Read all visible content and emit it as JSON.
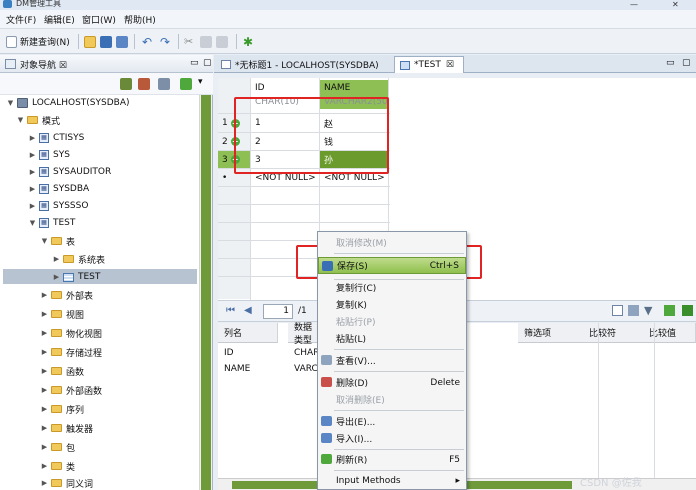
{
  "window": {
    "title": "DM管理工具"
  },
  "menu": [
    "文件(F)",
    "编辑(E)",
    "窗口(W)",
    "帮助(H)"
  ],
  "toolbar": {
    "new_query": "新建查询(N)"
  },
  "navigator": {
    "title": "对象导航",
    "close": "☒",
    "tree": {
      "server": "LOCALHOST(SYSDBA)",
      "schema_group": "模式",
      "schemas": [
        "CTISYS",
        "SYS",
        "SYSAUDITOR",
        "SYSDBA",
        "SYSSSO",
        "TEST"
      ],
      "table_group": "表",
      "system_tables": "系统表",
      "selected_table": "TEST",
      "other_groups": [
        "外部表",
        "视图",
        "物化视图",
        "存储过程",
        "函数",
        "外部函数",
        "序列",
        "触发器",
        "包",
        "类",
        "同义词"
      ]
    }
  },
  "tabs": [
    {
      "label": "*无标题1 - LOCALHOST(SYSDBA)"
    },
    {
      "label": "*TEST",
      "close": "☒"
    }
  ],
  "grid": {
    "columns": [
      {
        "name": "ID",
        "type": "CHAR(10)"
      },
      {
        "name": "NAME",
        "type": "VARCHAR2(50)"
      }
    ],
    "rows": [
      {
        "num": "1",
        "id": "1",
        "name": "赵"
      },
      {
        "num": "2",
        "id": "2",
        "name": "钱"
      },
      {
        "num": "3",
        "id": "3",
        "name": "孙"
      }
    ],
    "new_row": {
      "marker": "•",
      "id": "<NOT NULL>",
      "name": "<NOT NULL>"
    }
  },
  "pager": {
    "page": "1",
    "total": "/1"
  },
  "colgrid": {
    "headers": [
      "列名",
      "数据类型",
      "筛选项",
      "比较符",
      "比较值"
    ],
    "rows": [
      {
        "name": "ID",
        "type": "CHAR"
      },
      {
        "name": "NAME",
        "type": "VARC"
      }
    ]
  },
  "context_menu": {
    "items": [
      {
        "label": "取消修改(M)",
        "shortcut": "",
        "disabled": true
      },
      {
        "label": "保存(S)",
        "shortcut": "Ctrl+S",
        "highlighted": true
      },
      {
        "label": "复制行(C)",
        "shortcut": ""
      },
      {
        "label": "复制(K)",
        "shortcut": ""
      },
      {
        "label": "粘贴行(P)",
        "shortcut": "",
        "disabled": true
      },
      {
        "label": "粘贴(L)",
        "shortcut": ""
      },
      {
        "label": "查看(V)...",
        "shortcut": ""
      },
      {
        "label": "删除(D)",
        "shortcut": "Delete"
      },
      {
        "label": "取消删除(E)",
        "shortcut": "",
        "disabled": true
      },
      {
        "label": "导出(E)...",
        "shortcut": ""
      },
      {
        "label": "导入(I)...",
        "shortcut": ""
      },
      {
        "label": "刷新(R)",
        "shortcut": "F5"
      },
      {
        "label": "Input Methods",
        "shortcut": "▸"
      }
    ]
  },
  "watermark": "CSDN @佐我",
  "colors": {
    "accent_green": "#8fbf4e",
    "annotation_red": "#e02424"
  }
}
